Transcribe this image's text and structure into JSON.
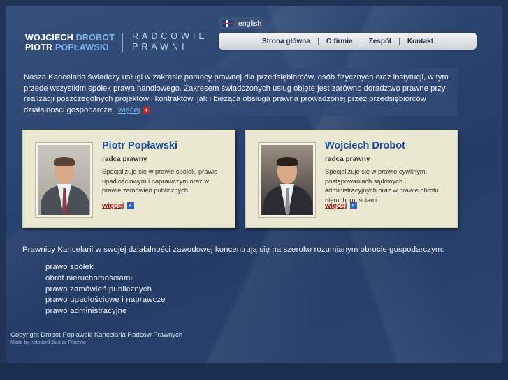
{
  "logo": {
    "line1_white": "WOJCIECH",
    "line1_blue": "DROBOT",
    "line2_white": "PIOTR",
    "line2_blue": "POPŁAWSKI",
    "subtitle_line1": "RADCOWIE",
    "subtitle_line2": "PRAWNI"
  },
  "language": {
    "label": "english",
    "icon": "uk-flag-icon"
  },
  "nav": {
    "items": [
      "Strona główna",
      "O firmie",
      "Zespół",
      "Kontakt"
    ]
  },
  "intro": {
    "text": "Nasza Kancelaria świadczy usługi w zakresie pomocy prawnej dla przedsiębiorców, osób fizycznych oraz instytucji, w tym przede wszystkim spółek prawa handlowego. Zakresem świadczonych usług objęte jest zarówno doradztwo prawne przy realizacji poszczególnych projektów i kontraktów, jak i bieżąca obsługa prawna prowadzonej przez przedsiębiorców działalności gospodarczej.",
    "more_label": "więcej",
    "more_icon": "»"
  },
  "lawyers": [
    {
      "name": "Piotr Popławski",
      "role": "radca prawny",
      "description": "Specjalizuje się w prawie spółek, prawie upadłościowym i naprawczym oraz w prawie zamówień publicznych.",
      "more_label": "więcej",
      "more_icon": "»"
    },
    {
      "name": "Wojciech Drobot",
      "role": "radca prawny",
      "description": "Specjalizuje się w prawie cywilnym, postępowaniach sądowych i administracyjnych oraz w prawie obrotu nieruchomościami.",
      "more_label": "więcej",
      "more_icon": "»"
    }
  ],
  "areas": {
    "intro": "Prawnicy Kancelarii w swojej działalności zawodowej koncentrują się na szeroko rozumianym obrocie gospodarczym:",
    "items": [
      "prawo spółek",
      "obrót nieruchomościami",
      "prawo zamówień publicznych",
      "prawo upadłościowe i naprawcze",
      "prawo administracyjne"
    ]
  },
  "footer": {
    "copyright": "Copyright Drobot Popławski Kancelaria Radców Prawnych",
    "made_by": "Made by netboard Janusz Płachno"
  },
  "colors": {
    "background": "#2a4470",
    "accent_blue": "#1a4a9c",
    "link_red": "#9b1d1d",
    "card": "#eae8d1"
  }
}
